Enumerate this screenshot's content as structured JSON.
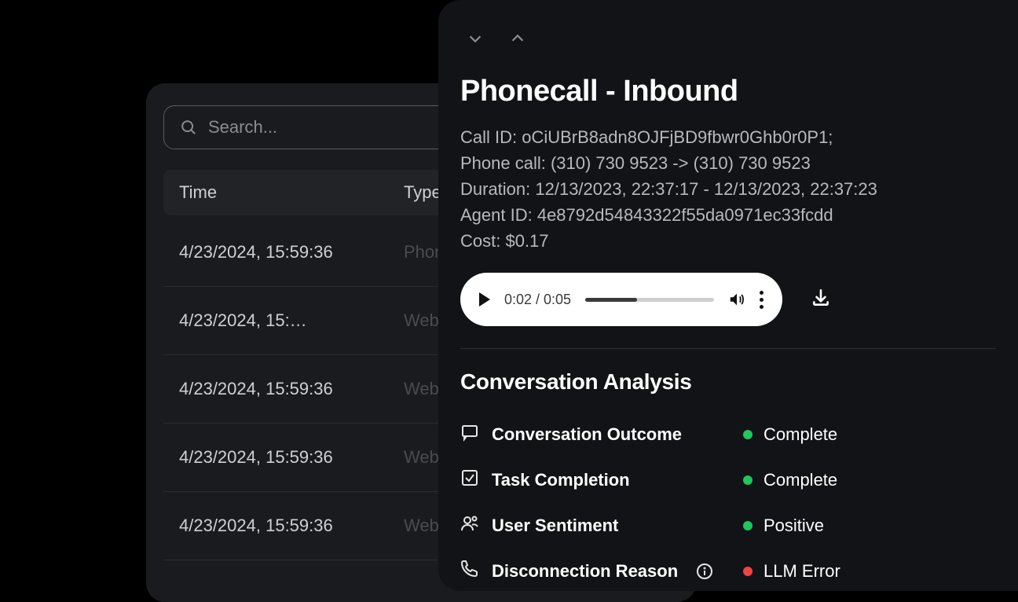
{
  "list": {
    "search_placeholder": "Search...",
    "headers": {
      "time": "Time",
      "type": "Type"
    },
    "rows": [
      {
        "time": "4/23/2024, 15:59:36",
        "type": "Phonecall"
      },
      {
        "time": "4/23/2024, 15:…",
        "type": "Webcall"
      },
      {
        "time": "4/23/2024, 15:59:36",
        "type": "Webcall"
      },
      {
        "time": "4/23/2024, 15:59:36",
        "type": "Webcall"
      },
      {
        "time": "4/23/2024, 15:59:36",
        "type": "Webcall"
      }
    ]
  },
  "detail": {
    "title": "Phonecall - Inbound",
    "call_id_line": "Call ID: oCiUBrB8adn8OJFjBD9fbwr0Ghb0r0P1;",
    "phone_line": "Phone call: (310) 730 9523 -> (310) 730 9523",
    "duration_line": "Duration: 12/13/2023, 22:37:17 - 12/13/2023, 22:37:23",
    "agent_line": "Agent ID:  4e8792d54843322f55da0971ec33fcdd",
    "cost_line": "Cost: $0.17",
    "audio": {
      "time": "0:02 / 0:05",
      "progress_pct": 40
    },
    "analysis_title": "Conversation Analysis",
    "analysis": [
      {
        "icon": "chat",
        "label": "Conversation Outcome",
        "value": "Complete",
        "dot": "green",
        "info": false
      },
      {
        "icon": "check",
        "label": "Task Completion",
        "value": "Complete",
        "dot": "green",
        "info": false
      },
      {
        "icon": "user",
        "label": "User Sentiment",
        "value": "Positive",
        "dot": "green",
        "info": false
      },
      {
        "icon": "phone",
        "label": "Disconnection Reason",
        "value": "LLM Error",
        "dot": "red",
        "info": true
      }
    ]
  }
}
